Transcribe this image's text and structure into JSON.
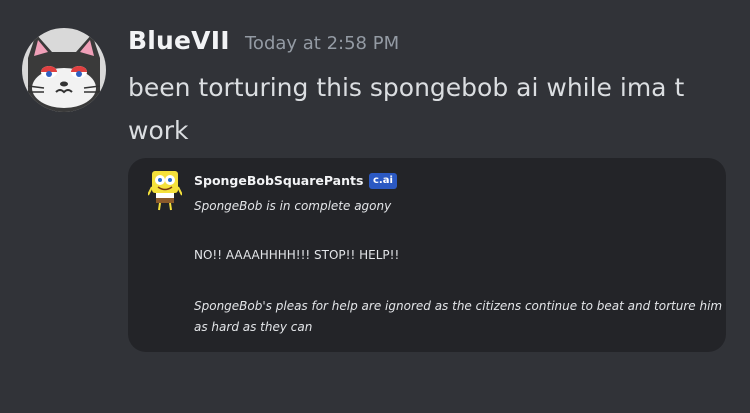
{
  "message": {
    "username": "BlueVII",
    "timestamp": "Today at 2:58 PM",
    "text": "been torturing this spongebob ai while ima t work",
    "avatar_icon": "cat-avatar-icon"
  },
  "embed": {
    "character_name": "SpongeBobSquarePants",
    "badge": "c.ai",
    "avatar_icon": "spongebob-avatar-icon",
    "lines": [
      "SpongeBob is in complete agony",
      "NO!! AAAAHHHH!!! STOP!!  HELP!!",
      "SpongeBob's pleas for help are ignored as the citizens continue to beat and torture him as hard as they can"
    ]
  },
  "colors": {
    "background": "#313338",
    "embed_background": "#232428",
    "badge": "#2b59c3"
  }
}
